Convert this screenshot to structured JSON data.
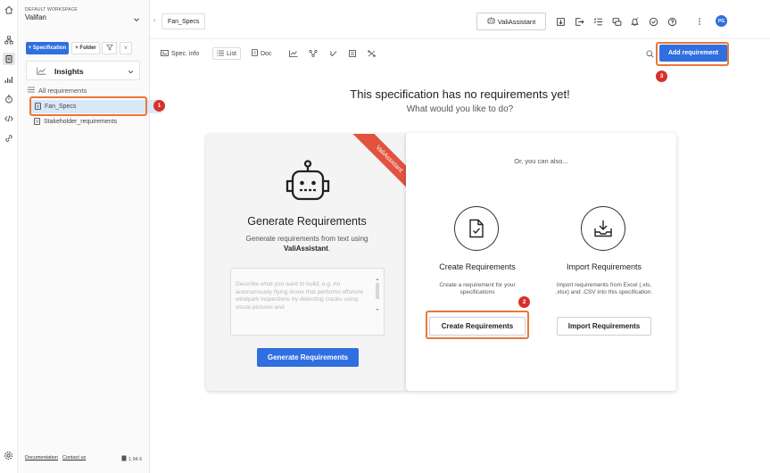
{
  "workspace": {
    "label": "DEFAULT WORKSPACE",
    "name": "Valifan"
  },
  "sidebar": {
    "spec_button": "+ Specification",
    "folder_button": "+ Folder",
    "more_button": "v",
    "insights_label": "Insights",
    "all_requirements": "All requirements",
    "items": [
      {
        "label": "Fan_Specs",
        "selected": true
      },
      {
        "label": "Stakeholder_requirements",
        "selected": false
      }
    ],
    "footer": {
      "documentation": "Documentation",
      "contact": "Contact us",
      "version": "1.94.6"
    }
  },
  "topbar": {
    "tab": "Fan_Specs",
    "assistant_button": "ValiAssistant",
    "avatar_initials": "PG"
  },
  "toolbar": {
    "spec_info": "Spec. info",
    "list": "List",
    "doc": "Doc",
    "add_requirement": "Add requirement"
  },
  "main": {
    "title": "This specification has no requirements yet!",
    "subtitle": "What would you like to do?"
  },
  "generate_card": {
    "ribbon": "ValiAssistant",
    "title": "Generate Requirements",
    "description": "Generate requirements from text using",
    "description_bold": "ValiAssistant",
    "description_end": ".",
    "textarea_placeholder": "Describe what you want to build, e.g. An autonomously flying drone that performs offshore windpark inspections by detecting cracks using visual pictures and",
    "button": "Generate Requirements"
  },
  "options_card": {
    "intro": "Or, you can also...",
    "create": {
      "title": "Create Requirements",
      "description": "Create a requirement for your specifications",
      "button": "Create Requirements"
    },
    "import": {
      "title": "Import Requirements",
      "description": "Import requirements from Excel (.xls, .xlsx) and .CSV into this specification.",
      "button": "Import Requirements"
    }
  },
  "annotations": {
    "step1": "1",
    "step2": "2",
    "step3": "3"
  },
  "colors": {
    "primary": "#2f6fe0",
    "highlight": "#e8773a",
    "badge": "#d9302c",
    "ribbon": "#e1533f",
    "selected_bg": "#d9e8f7"
  },
  "icons": {
    "rail": [
      "home-icon",
      "org-icon",
      "spec-icon",
      "insights-icon",
      "timer-icon",
      "code-icon",
      "link-icon"
    ],
    "top": [
      "import-icon",
      "export-icon",
      "list-check-icon",
      "review-icon",
      "notification-icon",
      "clock-check-icon",
      "help-icon",
      "more-vertical-icon"
    ]
  }
}
